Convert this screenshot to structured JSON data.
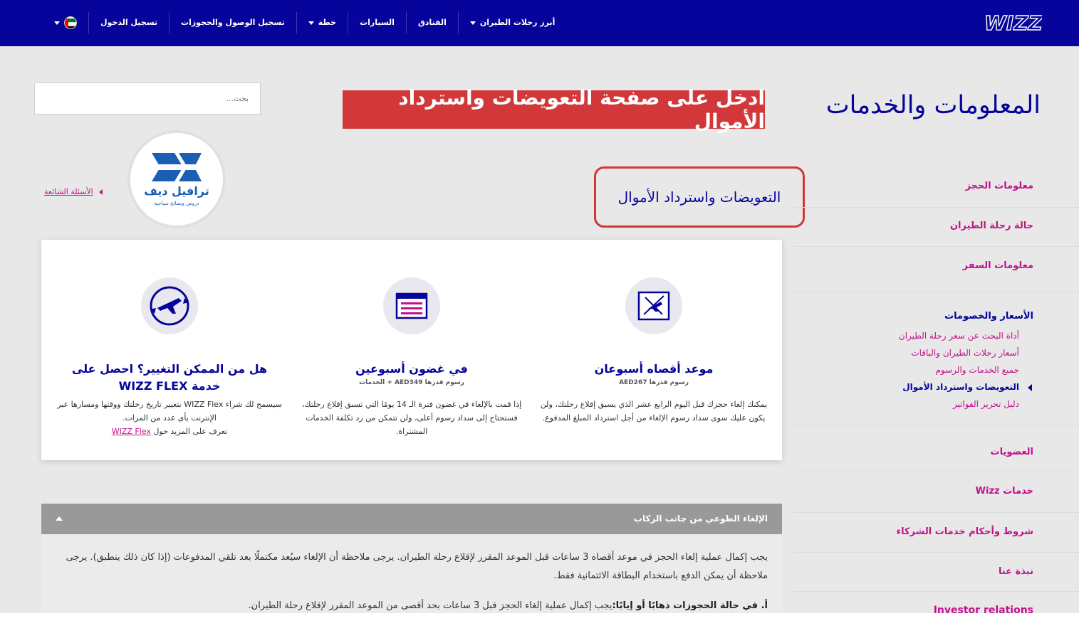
{
  "header": {
    "logo_text": "WIZZ",
    "nav": [
      {
        "label": "أبرز رحلات الطيران",
        "dropdown": true
      },
      {
        "label": "الفنادق",
        "dropdown": false
      },
      {
        "label": "السيارات",
        "dropdown": false
      },
      {
        "label": "خطة",
        "dropdown": true
      },
      {
        "label": "تسجيل الوصول والحجوزات",
        "dropdown": false
      },
      {
        "label": "تسجيل الدخول",
        "dropdown": false
      }
    ]
  },
  "page": {
    "title": "المعلومات والخدمات",
    "banner": "ادخل على صفحة التعويضات واسترداد الأموال",
    "search_placeholder": "بحث...",
    "brand_name": "ترافيل ديف",
    "brand_tagline": "دروس ونصائح سياحية",
    "faq_link": "الأسئلة الشائعة",
    "section_heading": "التعويضات واسترداد الأموال"
  },
  "cards": [
    {
      "icon": "cancelled-flight-icon",
      "title": "موعد أقصاه أسبوعان",
      "fee": "رسوم قدرها AED267",
      "text": "يمكنك إلغاء حجزك قبل اليوم الرابع عشر الذي يسبق إقلاع رحلتك، ولن يكون عليك سوى سداد رسوم الإلغاء من أجل استرداد المبلغ المدفوع."
    },
    {
      "icon": "calendar-icon",
      "title": "في غضون أسبوعين",
      "fee": "رسوم قدرها AED349 + الخدمات",
      "text": "إذا قمت بالإلغاء في غضون فترة الـ 14 يومًا التي تسبق إقلاع رحلتك، فستحتاج إلى سداد رسوم أعلى، ولن تتمكن من رد تكلفة الخدمات المشتراة."
    },
    {
      "icon": "flight-change-icon",
      "title": "هل من الممكن التغيير؟ احصل على خدمة WIZZ FLEX",
      "fee": "",
      "text": "سيسمح لك شراء WIZZ Flex بتغيير تاريخ رحلتك ووقتها ومسارها عبر الإنترنت بأي عدد من المرات.",
      "text_prefix": "تعرف على المزيد حول",
      "link": "WIZZ Flex"
    }
  ],
  "accordion": {
    "title": "الإلغاء الطوعي من جانب الركاب",
    "paragraph1": "يجب إكمال عملية إلغاء الحجز في موعد أقصاه 3 ساعات قبل الموعد المقرر لإقلاع رحلة الطيران. يرجى ملاحظة أن الإلغاء سيُعد مكتملًا بعد تلقي المدفوعات (إذا كان ذلك ينطبق). يرجى ملاحظة أن يمكن الدفع باستخدام البطاقة الائتمانية فقط.",
    "paragraph2_bold": "أ. في حالة الحجوزات ذهابًا أو إيابًا:",
    "paragraph2": "يجب إكمال عملية إلغاء الحجز قبل 3 ساعات بحد أقصى من الموعد المقرر لإقلاع رحلة الطيران."
  },
  "sidebar": {
    "items": [
      "معلومات الحجز",
      "حالة رحلة الطيران",
      "معلومات السفر",
      "الأسعار والخصومات",
      "العضويات",
      "خدمات Wizz",
      "شروط وأحكام خدمات الشركاء",
      "نبذة عنا",
      "Investor relations"
    ],
    "subitems": [
      "أداة البحث عن سعر رحلة الطيران",
      "أسعار رحلات الطيران والباقات",
      "جميع الخدمات والرسوم",
      "التعويضات واسترداد الأموال",
      "دليل تحرير الفواتير"
    ]
  },
  "colors": {
    "brand_navy": "#06049a",
    "brand_magenta": "#c2118b",
    "highlight_red": "#d2373a"
  }
}
